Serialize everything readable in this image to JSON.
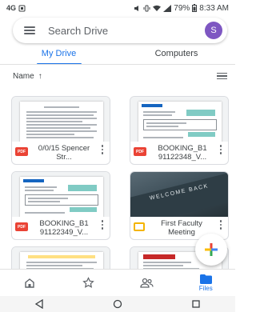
{
  "status_bar": {
    "left_indicator": "4G",
    "battery": "79%",
    "time": "8:33 AM"
  },
  "search": {
    "placeholder": "Search Drive",
    "avatar_initial": "S"
  },
  "tabs": [
    {
      "label": "My Drive",
      "active": true
    },
    {
      "label": "Computers",
      "active": false
    }
  ],
  "sort": {
    "label": "Name"
  },
  "files": [
    {
      "name": "0/0/15 Spencer Str...",
      "type": "PDF",
      "icon": "pdf-icon"
    },
    {
      "name": "BOOKING_B1 91122348_V...",
      "type": "PDF",
      "icon": "pdf-icon"
    },
    {
      "name": "BOOKING_B1 91122349_V...",
      "type": "PDF",
      "icon": "pdf-icon"
    },
    {
      "name": "First Faculty Meeting",
      "type": "Slides",
      "icon": "slides-icon",
      "thumb_text": "WELCOME BACK"
    },
    {
      "name": "",
      "type": "PDF",
      "icon": "pdf-icon"
    },
    {
      "name": "",
      "type": "PDF",
      "icon": "pdf-icon"
    }
  ],
  "bottom_nav": [
    {
      "label": "",
      "icon": "home-icon",
      "active": false
    },
    {
      "label": "",
      "icon": "star-icon",
      "active": false
    },
    {
      "label": "",
      "icon": "shared-icon",
      "active": false
    },
    {
      "label": "Files",
      "icon": "folder-icon",
      "active": true
    }
  ],
  "colors": {
    "accent": "#1a73e8",
    "pdf": "#ea4335",
    "slides": "#f4b400",
    "avatar": "#7e57c2"
  }
}
